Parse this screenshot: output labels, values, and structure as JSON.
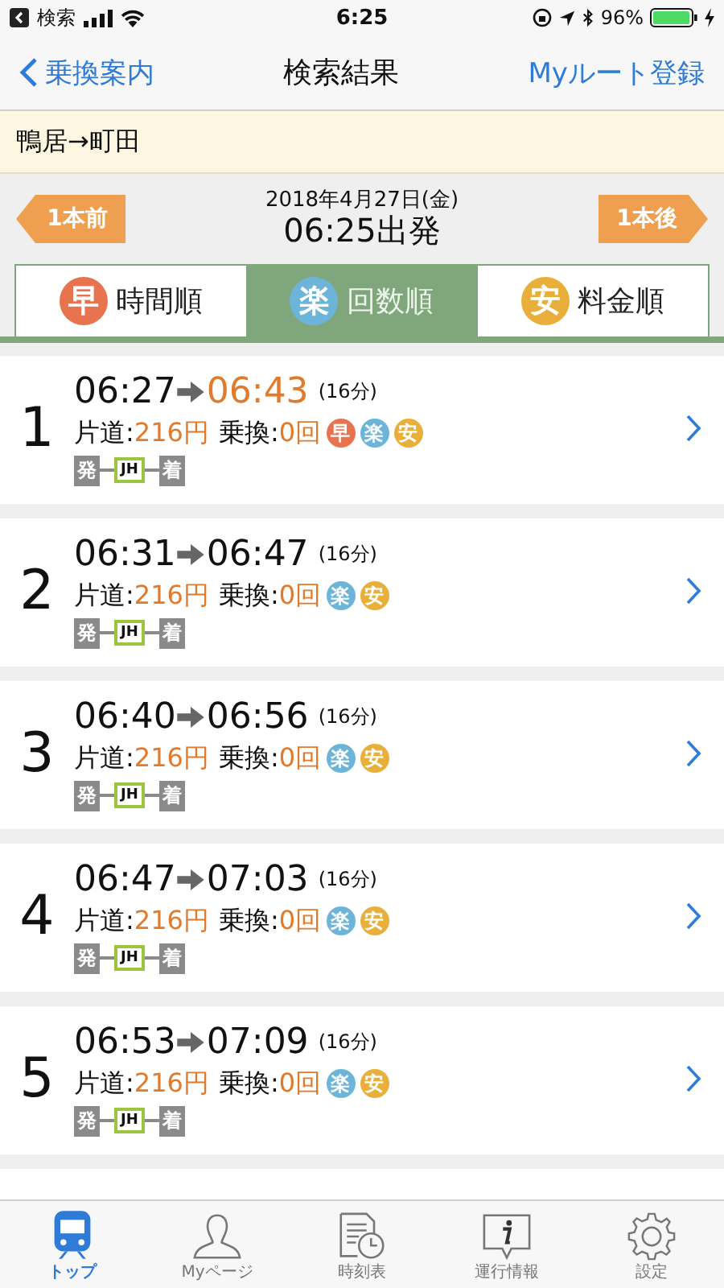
{
  "status_bar": {
    "back_app": "検索",
    "time": "6:25",
    "battery": "96%"
  },
  "nav": {
    "back": "乗換案内",
    "title": "検索結果",
    "action": "Myルート登録"
  },
  "route": "鴨居→町田",
  "departure": {
    "prev": "1本前",
    "date": "2018年4月27日(金)",
    "time": "06:25出発",
    "next": "1本後"
  },
  "sort_tabs": [
    {
      "kind": "fast",
      "icon": "早",
      "label": "時間順",
      "selected": false
    },
    {
      "kind": "easy",
      "icon": "楽",
      "label": "回数順",
      "selected": true
    },
    {
      "kind": "cheap",
      "icon": "安",
      "label": "料金順",
      "selected": false
    }
  ],
  "results": [
    {
      "number": "1",
      "depart": "06:27",
      "arrive": "06:43",
      "arrive_highlighted": true,
      "duration": "(16分)",
      "fare_label": "片道:",
      "fare": "216円",
      "transfer_label": "乗換:",
      "transfers": "0回",
      "badges": [
        {
          "kind": "fast",
          "text": "早"
        },
        {
          "kind": "easy",
          "text": "楽"
        },
        {
          "kind": "cheap",
          "text": "安"
        }
      ],
      "path": [
        "発",
        "JH",
        "着"
      ]
    },
    {
      "number": "2",
      "depart": "06:31",
      "arrive": "06:47",
      "arrive_highlighted": false,
      "duration": "(16分)",
      "fare_label": "片道:",
      "fare": "216円",
      "transfer_label": "乗換:",
      "transfers": "0回",
      "badges": [
        {
          "kind": "easy",
          "text": "楽"
        },
        {
          "kind": "cheap",
          "text": "安"
        }
      ],
      "path": [
        "発",
        "JH",
        "着"
      ]
    },
    {
      "number": "3",
      "depart": "06:40",
      "arrive": "06:56",
      "arrive_highlighted": false,
      "duration": "(16分)",
      "fare_label": "片道:",
      "fare": "216円",
      "transfer_label": "乗換:",
      "transfers": "0回",
      "badges": [
        {
          "kind": "easy",
          "text": "楽"
        },
        {
          "kind": "cheap",
          "text": "安"
        }
      ],
      "path": [
        "発",
        "JH",
        "着"
      ]
    },
    {
      "number": "4",
      "depart": "06:47",
      "arrive": "07:03",
      "arrive_highlighted": false,
      "duration": "(16分)",
      "fare_label": "片道:",
      "fare": "216円",
      "transfer_label": "乗換:",
      "transfers": "0回",
      "badges": [
        {
          "kind": "easy",
          "text": "楽"
        },
        {
          "kind": "cheap",
          "text": "安"
        }
      ],
      "path": [
        "発",
        "JH",
        "着"
      ]
    },
    {
      "number": "5",
      "depart": "06:53",
      "arrive": "07:09",
      "arrive_highlighted": false,
      "duration": "(16分)",
      "fare_label": "片道:",
      "fare": "216円",
      "transfer_label": "乗換:",
      "transfers": "0回",
      "badges": [
        {
          "kind": "easy",
          "text": "楽"
        },
        {
          "kind": "cheap",
          "text": "安"
        }
      ],
      "path": [
        "発",
        "JH",
        "着"
      ]
    }
  ],
  "tab_bar": [
    {
      "kind": "train",
      "label": "トップ",
      "selected": true
    },
    {
      "kind": "person",
      "label": "Myページ",
      "selected": false
    },
    {
      "kind": "timetable",
      "label": "時刻表",
      "selected": false
    },
    {
      "kind": "info",
      "label": "運行情報",
      "selected": false
    },
    {
      "kind": "gear",
      "label": "設定",
      "selected": false
    }
  ]
}
